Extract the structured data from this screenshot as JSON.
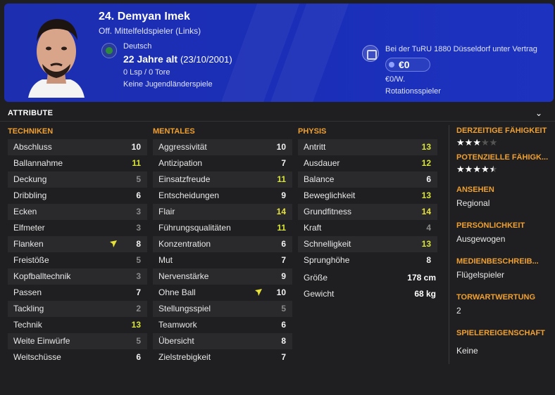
{
  "header": {
    "player_name": "24. Demyan Imek",
    "position": "Off. Mittelfeldspieler (Links)",
    "nationality": "Deutsch",
    "age": "22 Jahre alt",
    "dob": "(23/10/2001)",
    "appearances": "0 Lsp / 0 Tore",
    "youth": "Keine Jugendländerspiele",
    "contract": "Bei der TuRU 1880 Düsseldorf unter Vertrag",
    "value": "€0",
    "wage": "€0/W.",
    "role": "Rotationsspieler",
    "colors": {
      "accent": "#1d2fb0"
    }
  },
  "section": {
    "title": "ATTRIBUTE",
    "chevron": "chevron-down-icon"
  },
  "columns": {
    "technical": {
      "title": "TECHNIKEN",
      "items": [
        {
          "label": "Abschluss",
          "value": "10"
        },
        {
          "label": "Ballannahme",
          "value": "11"
        },
        {
          "label": "Deckung",
          "value": "5"
        },
        {
          "label": "Dribbling",
          "value": "6"
        },
        {
          "label": "Ecken",
          "value": "3"
        },
        {
          "label": "Elfmeter",
          "value": "3"
        },
        {
          "label": "Flanken",
          "value": "8"
        },
        {
          "label": "Freistöße",
          "value": "5"
        },
        {
          "label": "Kopfballtechnik",
          "value": "3"
        },
        {
          "label": "Passen",
          "value": "7"
        },
        {
          "label": "Tackling",
          "value": "2"
        },
        {
          "label": "Technik",
          "value": "13"
        },
        {
          "label": "Weite Einwürfe",
          "value": "5"
        },
        {
          "label": "Weitschüsse",
          "value": "6"
        }
      ]
    },
    "mental": {
      "title": "MENTALES",
      "items": [
        {
          "label": "Aggressivität",
          "value": "10"
        },
        {
          "label": "Antizipation",
          "value": "7"
        },
        {
          "label": "Einsatzfreude",
          "value": "11"
        },
        {
          "label": "Entscheidungen",
          "value": "9"
        },
        {
          "label": "Flair",
          "value": "14"
        },
        {
          "label": "Führungsqualitäten",
          "value": "11"
        },
        {
          "label": "Konzentration",
          "value": "6"
        },
        {
          "label": "Mut",
          "value": "7"
        },
        {
          "label": "Nervenstärke",
          "value": "9"
        },
        {
          "label": "Ohne Ball",
          "value": "10"
        },
        {
          "label": "Stellungsspiel",
          "value": "5"
        },
        {
          "label": "Teamwork",
          "value": "6"
        },
        {
          "label": "Übersicht",
          "value": "8"
        },
        {
          "label": "Zielstrebigkeit",
          "value": "7"
        }
      ]
    },
    "physical": {
      "title": "PHYSIS",
      "items": [
        {
          "label": "Antritt",
          "value": "13"
        },
        {
          "label": "Ausdauer",
          "value": "12"
        },
        {
          "label": "Balance",
          "value": "6"
        },
        {
          "label": "Beweglichkeit",
          "value": "13"
        },
        {
          "label": "Grundfitness",
          "value": "14"
        },
        {
          "label": "Kraft",
          "value": "4"
        },
        {
          "label": "Schnelligkeit",
          "value": "13"
        },
        {
          "label": "Sprunghöhe",
          "value": "8"
        }
      ],
      "height_label": "Größe",
      "height": "178 cm",
      "weight_label": "Gewicht",
      "weight": "68 kg"
    }
  },
  "right_panel": {
    "current_ability_title": "DERZEITIGE FÄHIGKEIT",
    "current_ability_stars": 3,
    "potential_ability_title": "POTENZIELLE FÄHIGK...",
    "potential_ability_stars": 4.5,
    "reputation_title": "ANSEHEN",
    "reputation": "Regional",
    "personality_title": "PERSÖNLICHKEIT",
    "personality": "Ausgewogen",
    "media_title": "MEDIENBESCHREIB...",
    "media": "Flügelspieler",
    "gk_title": "TORWARTWERTUNG",
    "gk": "2",
    "traits_title": "SPIELEREIGENSCHAFT",
    "traits": "Keine"
  }
}
